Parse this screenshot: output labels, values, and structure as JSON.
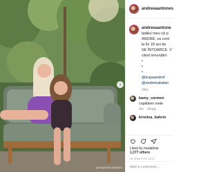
{
  "post": {
    "username": "andreeaantones",
    "photo_credit": "@ISADORA ANDREI"
  },
  "caption": {
    "username": "andreeaantone",
    "lines": [
      "tatălui meu că p",
      "ANDRÉ, va cont",
      "la fix 18 ani de",
      "SE ÎNTOARCE. V",
      "când renunțăm"
    ],
    "bullets": [
      "•",
      "•",
      "•"
    ],
    "mentions": [
      "@trupaandref",
      "@andreeabalan"
    ],
    "time": "26m"
  },
  "comments": [
    {
      "username": "kamy_carmen",
      "text": "copiilărei mele",
      "time": "9m",
      "reply_label": "Reply"
    },
    {
      "username": "kristina_bahrin",
      "text": "",
      "time": "",
      "reply_label": ""
    }
  ],
  "likes": {
    "text": "Liked by madalinar",
    "count": "1,377 others"
  },
  "posted_ago": "28 MINUTES AGO",
  "add_comment_placeholder": "Add a comment…",
  "colors": {
    "story_ring": "#d12b62",
    "link": "#00376b",
    "muted": "#8e8e8e"
  },
  "icons": [
    "heart-icon",
    "comment-icon",
    "share-icon",
    "chevron-right-icon"
  ]
}
